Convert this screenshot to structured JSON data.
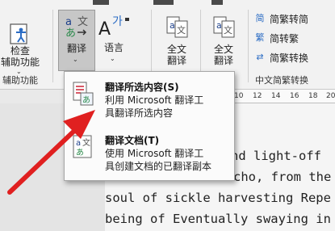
{
  "ribbon": {
    "check_button": {
      "label_line1": "检查",
      "label_line2": "辅助功能"
    },
    "accessibility_group_label": "辅助功能",
    "translate_button": {
      "label": "翻译"
    },
    "language_button": {
      "label": "语言"
    },
    "full_translate_1": {
      "label_line1": "全文",
      "label_line2": "翻译"
    },
    "full_translate_2": {
      "label_line1": "全文",
      "label_line2": "翻译"
    },
    "simp_trad": [
      {
        "label": "简繁转简",
        "icon": "traditional-to-simplified-icon"
      },
      {
        "label": "简转繁",
        "icon": "simplified-to-traditional-icon"
      },
      {
        "label": "简繁转换",
        "icon": "convert-icon"
      }
    ],
    "simp_trad_group_label": "中文简繁转换"
  },
  "ruler": {
    "ticks": [
      "10",
      "12",
      "14",
      "16",
      "18",
      "20"
    ]
  },
  "menu": {
    "items": [
      {
        "title": "翻译所选内容(S)",
        "desc_line1": "利用 Microsoft 翻译工",
        "desc_line2": "具翻译所选内容",
        "icon": "translate-selection-icon"
      },
      {
        "title": "翻译文档(T)",
        "desc_line1": "使用 Microsoft 翻译工",
        "desc_line2": "具创建文档的已翻译副本",
        "icon": "translate-document-icon"
      }
    ]
  },
  "document": {
    "lines": [
      "nd light-off",
      "cho, from the",
      "soul of sickle harvesting Repe",
      "being of Eventually swaying in"
    ]
  },
  "colors": {
    "accent": "#2b6cc4",
    "arrow": "#e02020",
    "selected_bg": "#c7c7c7"
  }
}
